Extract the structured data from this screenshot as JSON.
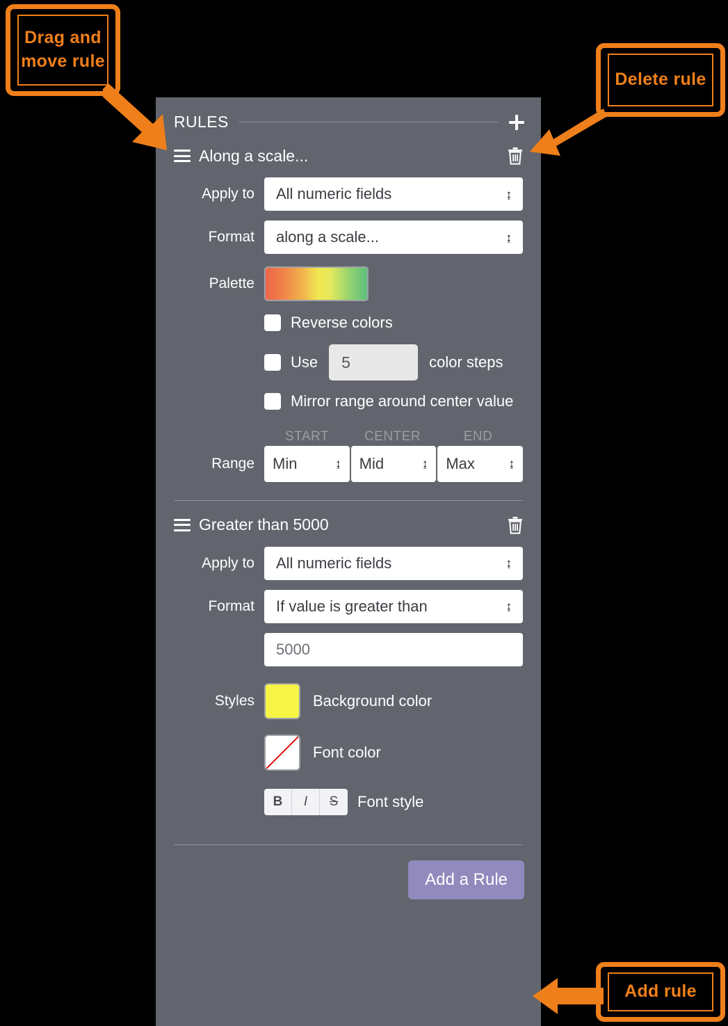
{
  "panel": {
    "header_title": "RULES",
    "add_icon": "plus-icon"
  },
  "rules": [
    {
      "title": "Along a scale...",
      "drag_icon": "drag-handle-icon",
      "delete_icon": "trash-icon",
      "apply_to_label": "Apply to",
      "apply_to_value": "All numeric fields",
      "format_label": "Format",
      "format_value": "along a scale...",
      "palette_label": "Palette",
      "palette_colors": [
        "#ec6649",
        "#f0e04f",
        "#f2ee55",
        "#5cbf7c"
      ],
      "reverse_colors_label": "Reverse colors",
      "reverse_colors_checked": false,
      "use_label": "Use",
      "color_steps_value": "5",
      "color_steps_label": "color steps",
      "use_steps_checked": false,
      "mirror_label": "Mirror range around center value",
      "mirror_checked": false,
      "range_label": "Range",
      "range_headers": [
        "START",
        "CENTER",
        "END"
      ],
      "range_values": [
        "Min",
        "Mid",
        "Max"
      ]
    },
    {
      "title": "Greater than 5000",
      "drag_icon": "drag-handle-icon",
      "delete_icon": "trash-icon",
      "apply_to_label": "Apply to",
      "apply_to_value": "All numeric fields",
      "format_label": "Format",
      "format_value": "If value is greater than",
      "threshold_value": "5000",
      "styles_label": "Styles",
      "background_color_caption": "Background color",
      "background_color_value": "#f6f545",
      "font_color_caption": "Font color",
      "font_color_value": "none",
      "font_style_caption": "Font style",
      "font_style_buttons": [
        "B",
        "I",
        "S"
      ]
    }
  ],
  "footer": {
    "add_rule_label": "Add a Rule",
    "add_rule_color": "#9289bd"
  },
  "annotations": {
    "accent_color": "#ef7f1a",
    "drag_move": "Drag and\nmove rule",
    "drag_move_line1": "Drag and",
    "drag_move_line2": "move rule",
    "delete_rule": "Delete rule",
    "add_rule": "Add rule"
  }
}
